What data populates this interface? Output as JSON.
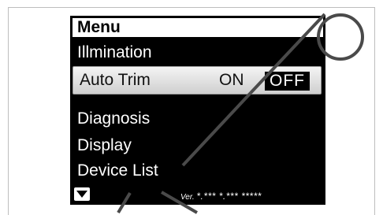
{
  "menu": {
    "title": "Menu",
    "items": [
      {
        "label": "Illmination"
      },
      {
        "label": "Auto Trim",
        "on_label": "ON",
        "off_label": "OFF",
        "selected": true
      },
      {
        "label": "Diagnosis"
      },
      {
        "label": "Display"
      },
      {
        "label": "Device List"
      }
    ]
  },
  "footer": {
    "version_prefix": "Ver.",
    "version_value": "*.*** *.*** *****",
    "down_icon": "triangle-down-icon"
  },
  "colors": {
    "screen_bg": "#000000",
    "text": "#ffffff",
    "selected_bg": "#e3e3e3",
    "watermark": "#4a4a4a"
  }
}
